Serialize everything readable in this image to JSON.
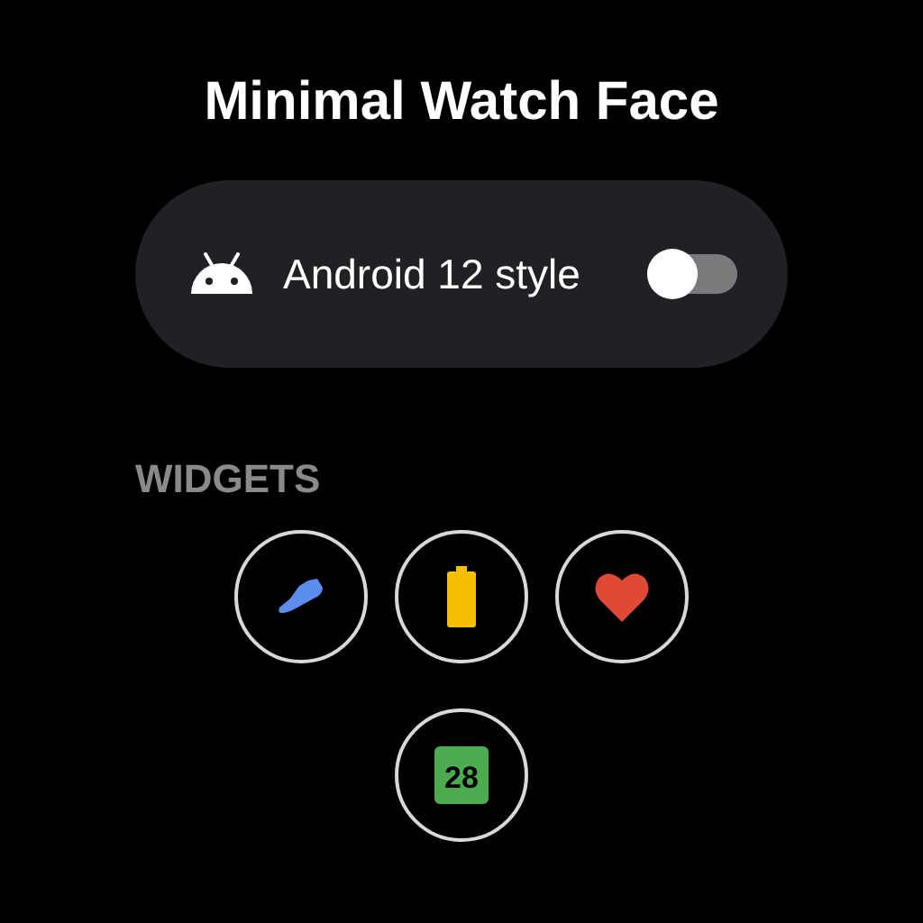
{
  "title": "Minimal Watch Face",
  "setting": {
    "label": "Android 12 style",
    "on": false
  },
  "section": "WIDGETS",
  "widgets": [
    {
      "kind": "shoe"
    },
    {
      "kind": "battery"
    },
    {
      "kind": "heart"
    },
    {
      "kind": "calendar",
      "text": "28"
    }
  ]
}
